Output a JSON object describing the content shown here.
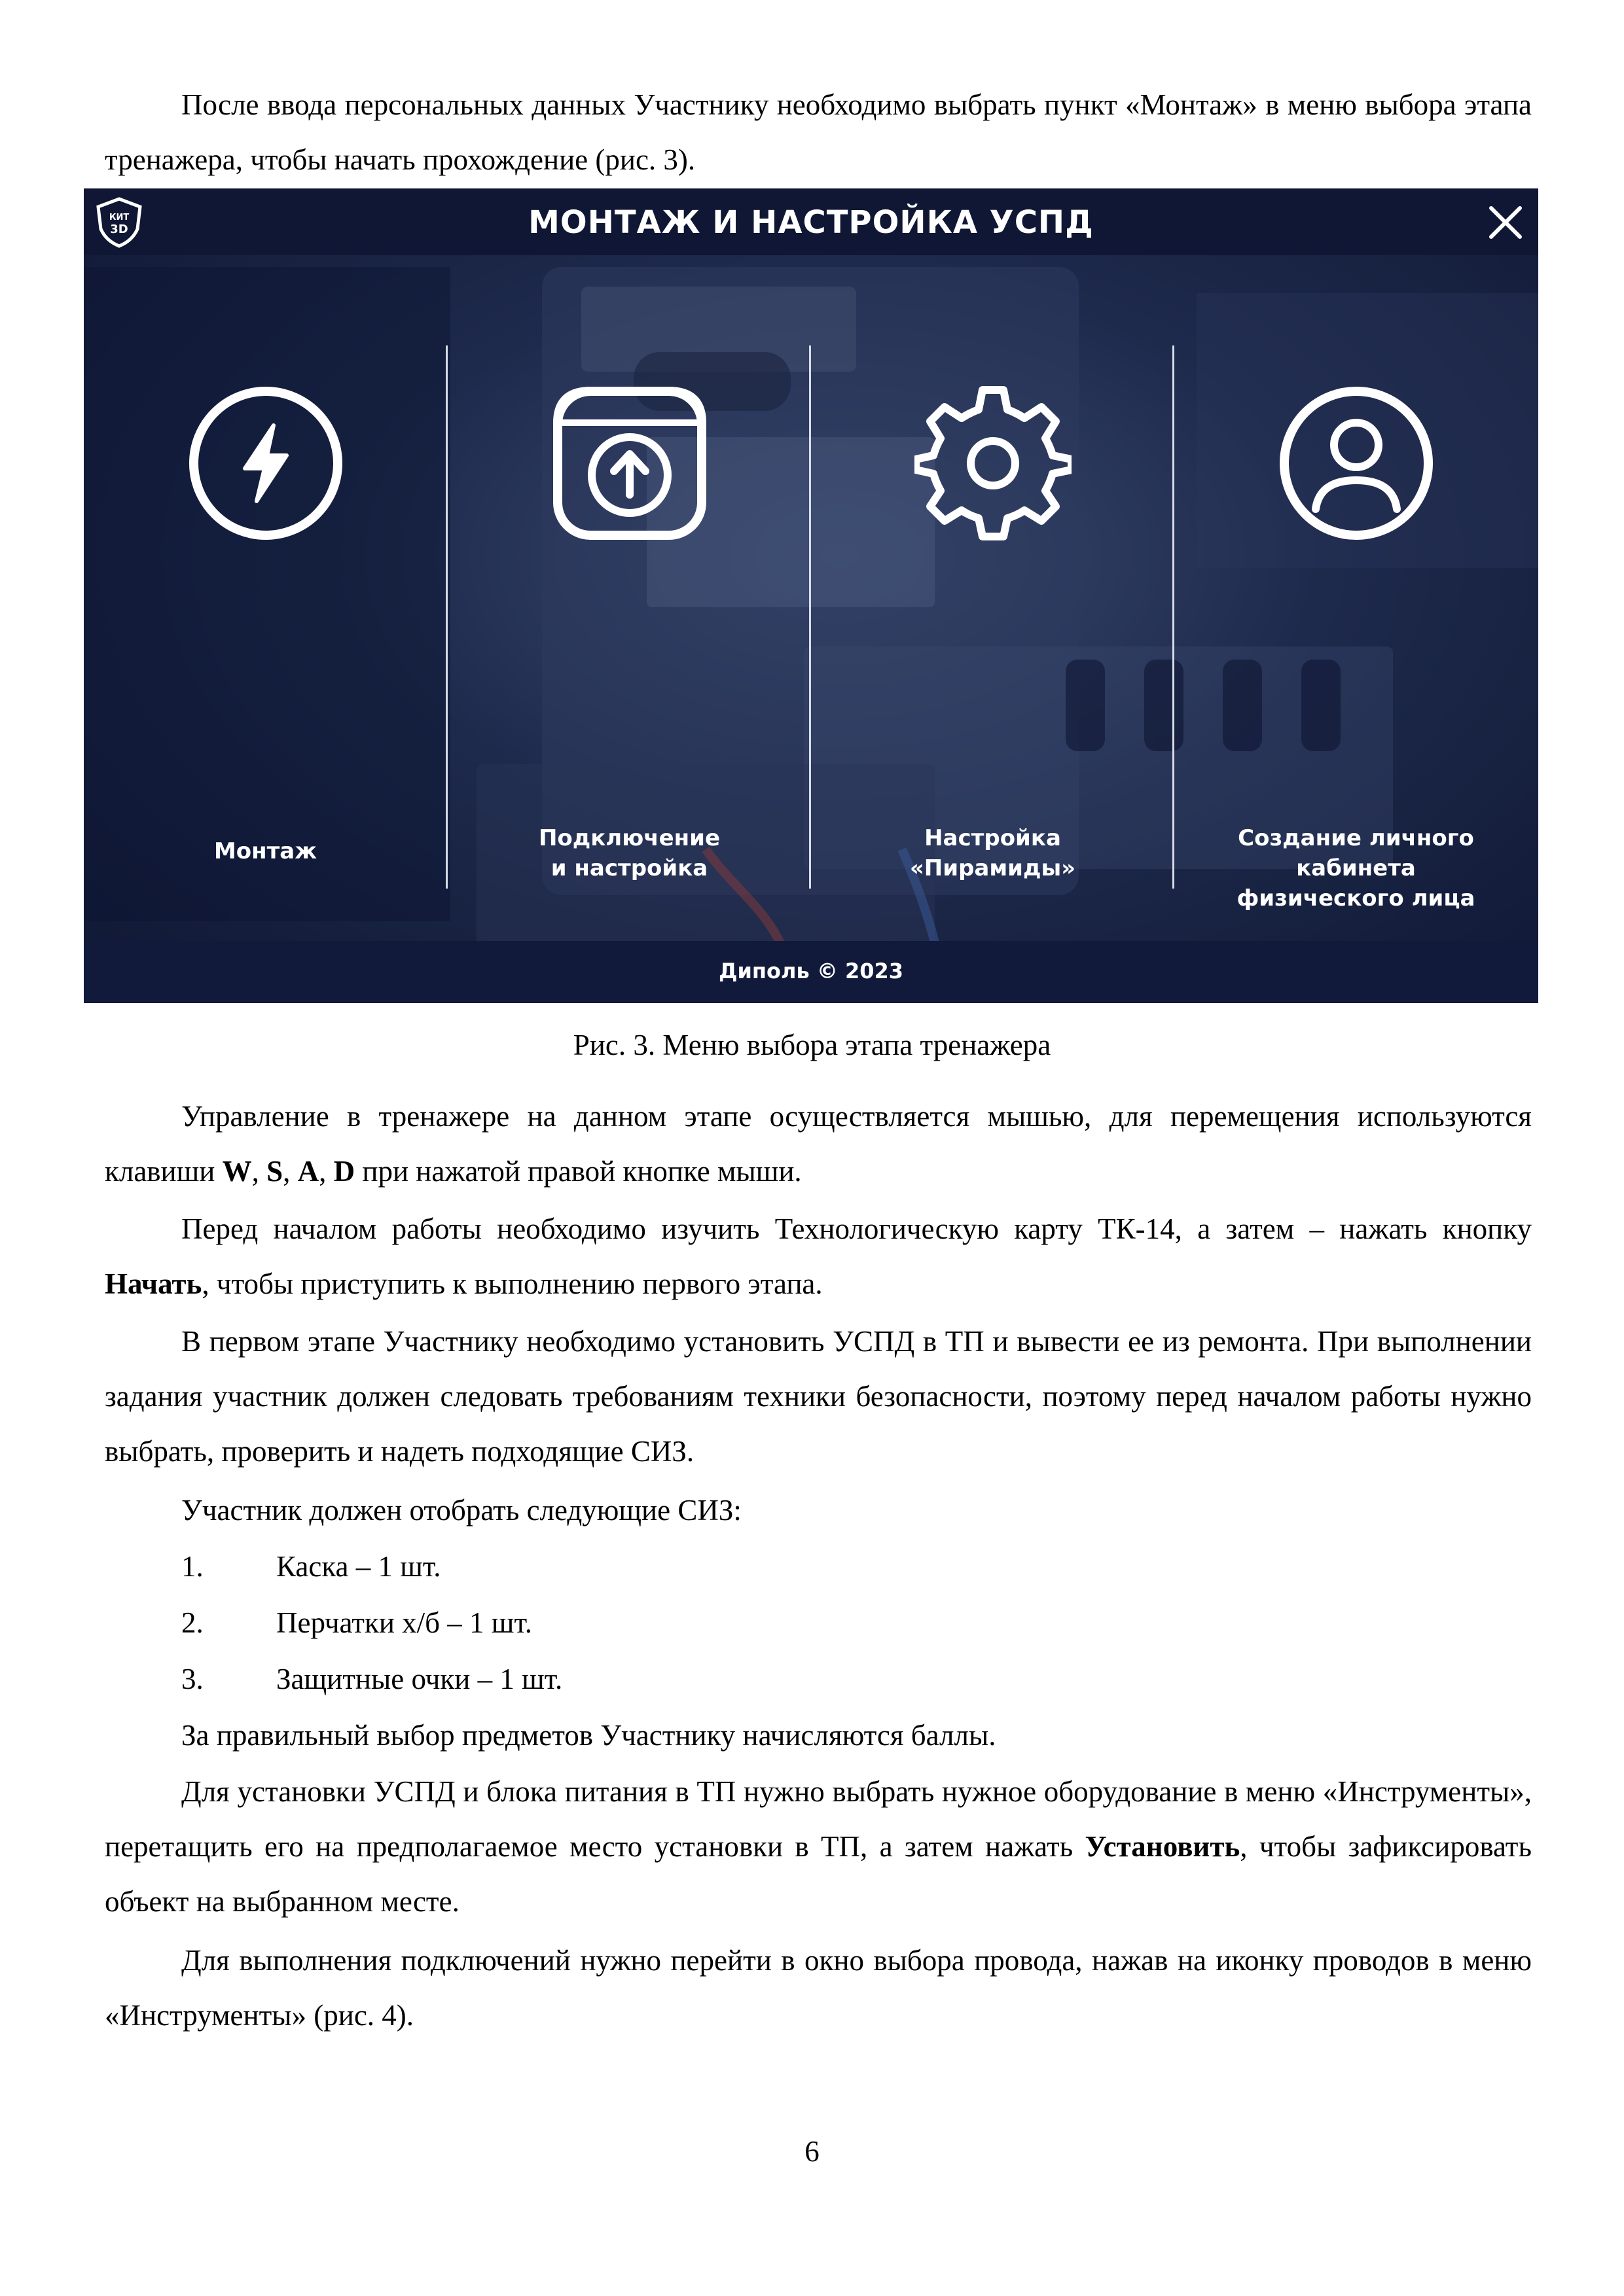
{
  "page": {
    "para1": "После ввода персональных данных Участнику необходимо выбрать пункт «Монтаж» в меню выбора этапа тренажера, чтобы начать прохождение (рис. 3).",
    "figure": {
      "title": "МОНТАЖ И НАСТРОЙКА УСПД",
      "logo_text": "КИТ 3D",
      "copyright": "Диполь © 2023",
      "items": [
        {
          "line1": "Монтаж",
          "line2": "",
          "icon": "lightning-icon"
        },
        {
          "line1": "Подключение",
          "line2": "и настройка",
          "icon": "upload-icon"
        },
        {
          "line1": "Настройка",
          "line2": "«Пирамиды»",
          "icon": "gear-icon"
        },
        {
          "line1": "Создание личного кабинета",
          "line2": "физического лица",
          "icon": "user-icon"
        }
      ],
      "caption": "Рис. 3. Меню выбора этапа тренажера"
    },
    "para2": {
      "prefix": "Управление в тренажере на данном этапе осуществляется мышью, для перемещения используются клавиши ",
      "k1": "W",
      "sep1": ", ",
      "k2": "S",
      "sep2": ", ",
      "k3": "A",
      "sep3": ", ",
      "k4": "D",
      "suffix": " при нажатой правой кнопке мыши."
    },
    "para3": {
      "prefix": "Перед началом работы необходимо изучить Технологическую карту ТК-14, а затем – нажать кнопку ",
      "bold": "Начать",
      "suffix": ", чтобы приступить к выполнению первого этапа."
    },
    "para4": "В первом этапе Участнику необходимо установить УСПД в ТП и вывести ее из ремонта. При выполнении задания участник должен следовать требованиям техники безопасности, поэтому перед началом работы нужно выбрать, проверить и надеть подходящие СИЗ.",
    "para5": "Участник должен отобрать следующие СИЗ:",
    "list": [
      {
        "num": "1.",
        "text": "Каска – 1 шт."
      },
      {
        "num": "2.",
        "text": "Перчатки х/б – 1 шт."
      },
      {
        "num": "3.",
        "text": "Защитные очки – 1 шт."
      }
    ],
    "para6": "За правильный выбор предметов Участнику начисляются баллы.",
    "para7": {
      "prefix": "Для установки УСПД и блока питания в ТП нужно выбрать нужное оборудование в меню «Инструменты», перетащить его на предполагаемое место установки в ТП, а затем нажать ",
      "bold": "Установить",
      "suffix": ", чтобы зафиксировать объект на выбранном месте."
    },
    "para8": "Для выполнения подключений нужно перейти в окно выбора провода, нажав на иконку проводов в меню «Инструменты» (рис. 4).",
    "page_number": "6"
  }
}
